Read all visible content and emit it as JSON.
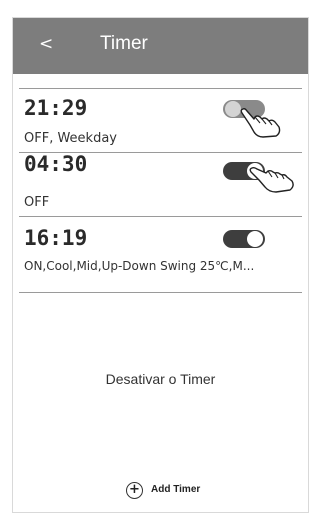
{
  "header": {
    "back_label": "<",
    "title": "Timer"
  },
  "timers": [
    {
      "time": "21:29",
      "description": "OFF, Weekday",
      "enabled": false
    },
    {
      "time": "04:30",
      "description": "OFF",
      "enabled": true
    },
    {
      "time": "16:19",
      "description": "ON,Cool,Mid,Up-Down Swing 25℃,M...",
      "enabled": true
    }
  ],
  "empty_message": "Desativar o Timer",
  "add_timer": {
    "label": "Add Timer",
    "icon": "plus-circle-icon"
  },
  "icons": {
    "back": "chevron-left-icon",
    "toggle": "toggle-switch",
    "pointer": "hand-pointer-icon"
  },
  "colors": {
    "header_bg": "#7d7d7d",
    "toggle_on": "#3e3e3e",
    "toggle_off": "#8a8a8a"
  }
}
